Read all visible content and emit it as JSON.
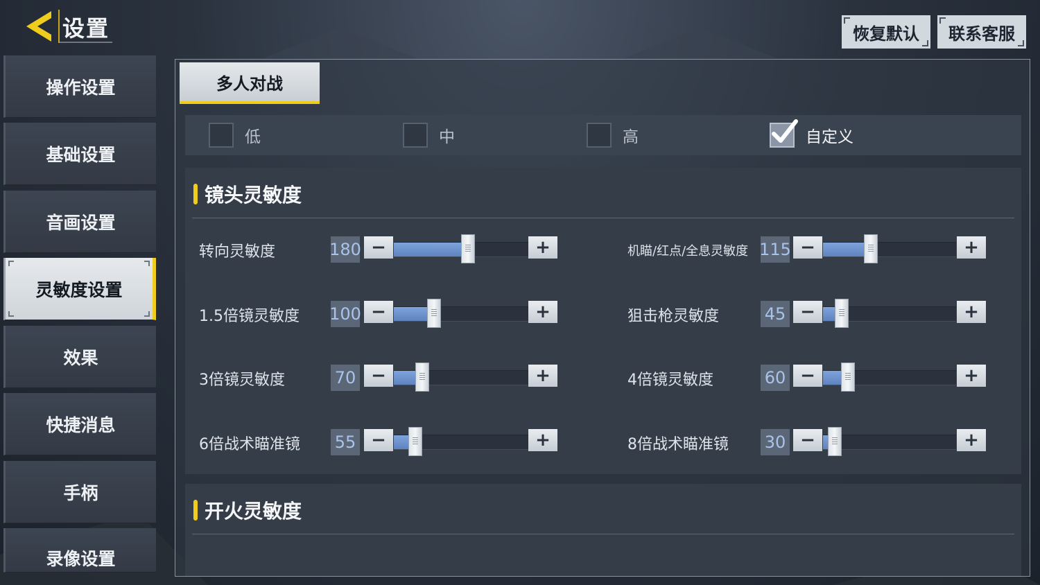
{
  "header": {
    "title": "设置",
    "restore_default": "恢复默认",
    "contact_support": "联系客服"
  },
  "colors": {
    "accent": "#f0cc1c",
    "slider_fill": "#6b90cc",
    "value_text": "#a9c3ea"
  },
  "sidebar": {
    "items": [
      {
        "label": "操作设置",
        "active": false
      },
      {
        "label": "基础设置",
        "active": false
      },
      {
        "label": "音画设置",
        "active": false
      },
      {
        "label": "灵敏度设置",
        "active": true
      },
      {
        "label": "效果",
        "active": false
      },
      {
        "label": "快捷消息",
        "active": false
      },
      {
        "label": "手柄",
        "active": false
      },
      {
        "label": "录像设置",
        "active": false
      }
    ]
  },
  "main": {
    "mode_tab": "多人对战",
    "presets": [
      {
        "label": "低",
        "checked": false
      },
      {
        "label": "中",
        "checked": false
      },
      {
        "label": "高",
        "checked": false
      },
      {
        "label": "自定义",
        "checked": true
      }
    ],
    "camera_section": {
      "title": "镜头灵敏度",
      "left": [
        {
          "label": "转向灵敏度",
          "value": "180",
          "ratio": 0.55
        },
        {
          "label": "1.5倍镜灵敏度",
          "value": "100",
          "ratio": 0.3
        },
        {
          "label": "3倍镜灵敏度",
          "value": "70",
          "ratio": 0.21
        },
        {
          "label": "6倍战术瞄准镜",
          "value": "55",
          "ratio": 0.16
        }
      ],
      "right": [
        {
          "label": "机瞄/红点/全息灵敏度",
          "value": "115",
          "ratio": 0.36
        },
        {
          "label": "狙击枪灵敏度",
          "value": "45",
          "ratio": 0.14
        },
        {
          "label": "4倍镜灵敏度",
          "value": "60",
          "ratio": 0.19
        },
        {
          "label": "8倍战术瞄准镜",
          "value": "30",
          "ratio": 0.09
        }
      ]
    },
    "fire_section": {
      "title": "开火灵敏度"
    }
  }
}
